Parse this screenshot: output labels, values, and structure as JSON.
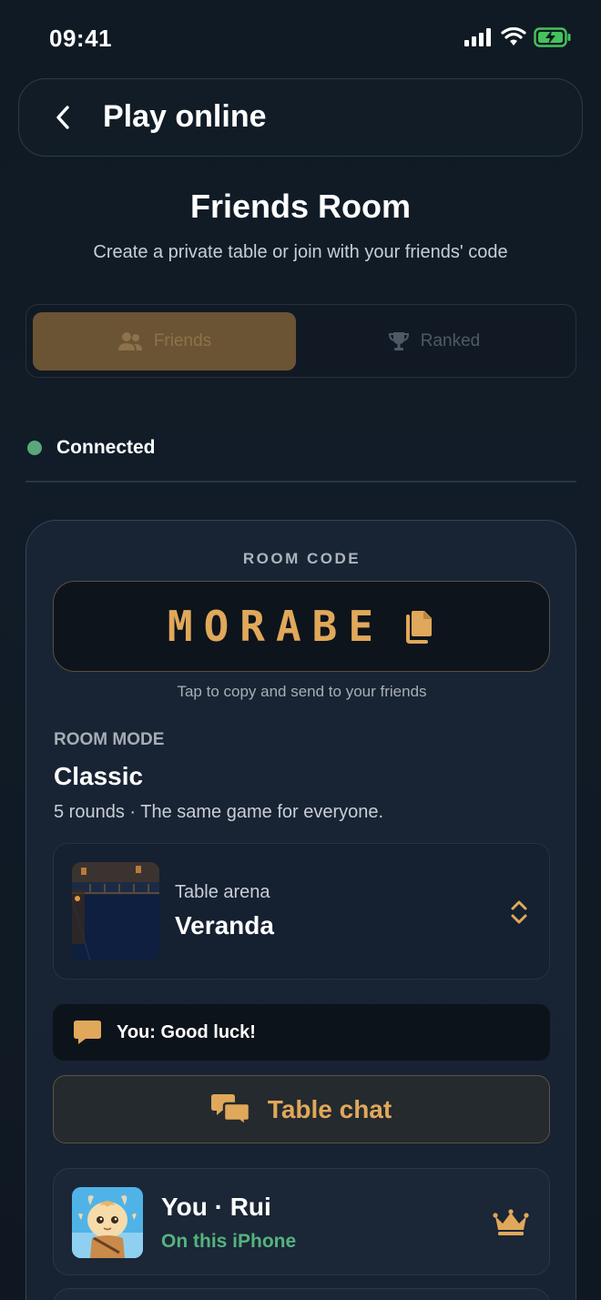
{
  "status": {
    "time": "09:41"
  },
  "header": {
    "title": "Play online"
  },
  "page": {
    "title": "Friends Room",
    "subtitle": "Create a private table or join with your friends' code"
  },
  "tabs": [
    {
      "label": "Friends",
      "icon": "users-icon",
      "active": true
    },
    {
      "label": "Ranked",
      "icon": "trophy-icon",
      "active": false
    }
  ],
  "connection": {
    "label": "Connected",
    "color": "#5aa77c"
  },
  "room": {
    "code_label": "ROOM CODE",
    "code": "MORABE",
    "code_hint": "Tap to copy and send to your friends",
    "mode_label": "ROOM MODE",
    "mode_value": "Classic",
    "mode_description": "5 rounds · The same game for everyone.",
    "arena_label": "Table arena",
    "arena_value": "Veranda",
    "chat_preview": "You: Good luck!",
    "table_chat_label": "Table chat"
  },
  "player": {
    "name": "You · Rui",
    "subtitle": "On this iPhone"
  },
  "colors": {
    "accent": "#e0a85a",
    "online": "#55b37e",
    "background": "#111c28"
  }
}
